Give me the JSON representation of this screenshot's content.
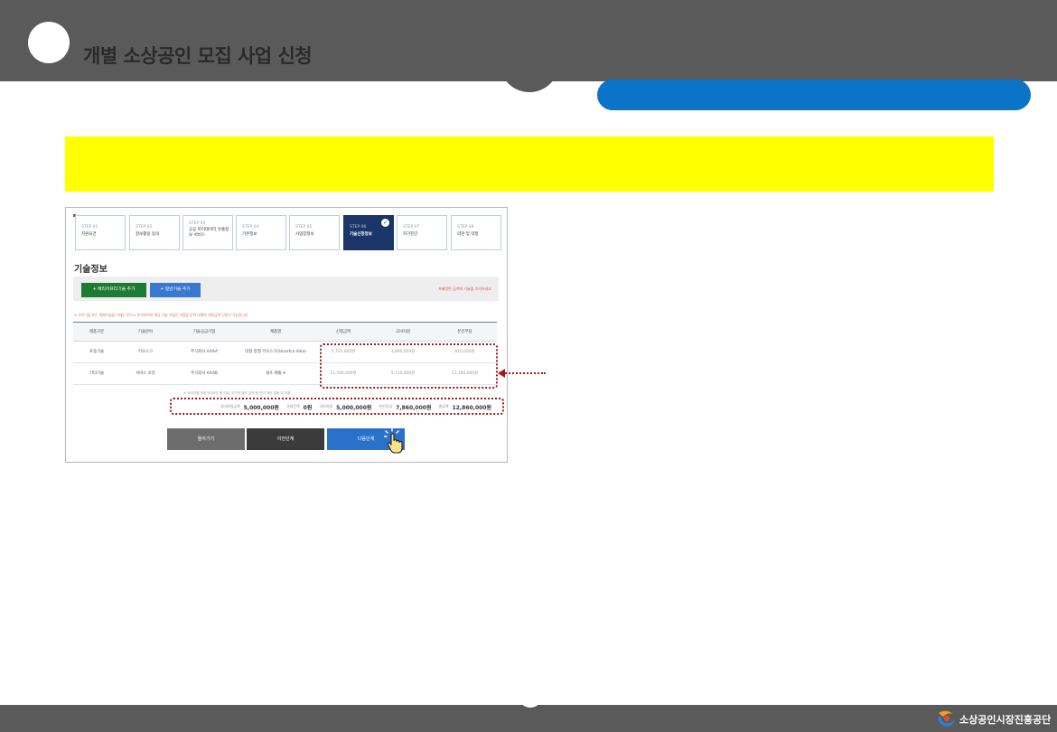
{
  "page": {
    "title": "개별 소상공인 모집 사업 신청",
    "footer_logo": "소상공인시장진흥공단"
  },
  "colors": {
    "header": "#5a5a5a",
    "accent_blue": "#0a74c8",
    "highlight_yellow": "#ffff00",
    "annotation_red": "#9e1c1c",
    "active_step": "#1b3568"
  },
  "steps": [
    {
      "num": "STEP 01",
      "name": "지원요건"
    },
    {
      "num": "STEP 02",
      "name": "정보활용 동의"
    },
    {
      "num": "STEP 03",
      "name": "공공 마이데이터 유출정보 서비스"
    },
    {
      "num": "STEP 04",
      "name": "기본정보"
    },
    {
      "num": "STEP 05",
      "name": "사업장정보"
    },
    {
      "num": "STEP 06",
      "name": "기술신청정보",
      "active": true
    },
    {
      "num": "STEP 07",
      "name": "자가진단"
    },
    {
      "num": "STEP 08",
      "name": "약관 및 약정"
    }
  ],
  "section": {
    "title": "기술정보",
    "add_barrier_free": "+ 배리어프리기술 추가",
    "add_general": "+ 일반기술 추가",
    "toolbar_note": "※배정된 금액에 기술을 추가하세요",
    "red_note": "※ 보유기술 또는 해제기술을 기재는 반드시 추가하여야 해당 기술 기술은 적용을 받아 대해야 대한금액 신청이 가능합니다"
  },
  "table": {
    "headers": [
      "제품구분",
      "기술분야",
      "기술공급기업",
      "제품명",
      "신청금액",
      "국비지원",
      "본인부담"
    ],
    "rows": [
      [
        "포용기술",
        "키오스크",
        "주식회사 AAAA",
        "대형 방행 키오스크(Smartco Vela)",
        "2,750,000원",
        "1,890,000원",
        "810,000원"
      ],
      [
        "기타기술",
        "서비스 로봇",
        "주식회사 AAAB",
        "쉐프 배출 A",
        "11,590,000원",
        "5,110,000원",
        "11,180,000원"
      ]
    ]
  },
  "summary": {
    "note": "※ 국비지원 범위 5000만 원 이내, 부가세 별도 금액 등 잔여 예산 범위 내 지원",
    "items": [
      {
        "label": "국비지원금액",
        "value": "5,000,000원"
      },
      {
        "label": "국비잔액",
        "value": "0원"
      },
      {
        "label": "국비지원",
        "value": "5,000,000원"
      },
      {
        "label": "본인부담",
        "value": "7,860,000원"
      },
      {
        "label": "총금액",
        "value": "12,860,000원"
      }
    ]
  },
  "nav": {
    "back": "돌아가기",
    "prev": "이전단계",
    "next": "다음단계"
  }
}
